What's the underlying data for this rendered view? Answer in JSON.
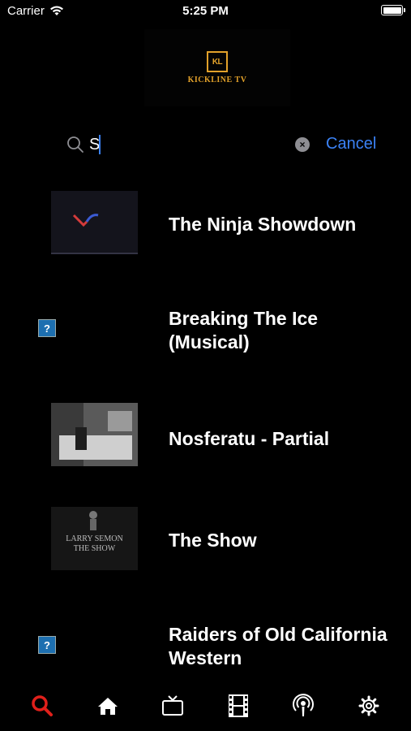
{
  "status_bar": {
    "carrier": "Carrier",
    "time": "5:25 PM"
  },
  "logo": {
    "mark": "KL",
    "text": "KICKLINE TV"
  },
  "search": {
    "value": "S",
    "cancel_label": "Cancel",
    "clear_symbol": "×"
  },
  "results": [
    {
      "title": "The Ninja Showdown",
      "thumbnail": "video-thumbnail"
    },
    {
      "title": "Breaking The Ice (Musical)",
      "thumbnail": "broken-image-icon",
      "placeholder": "?"
    },
    {
      "title": "Nosferatu - Partial",
      "thumbnail": "video-thumbnail"
    },
    {
      "title": "The Show",
      "thumbnail": "video-thumbnail",
      "thumb_text": [
        "LARRY SEMON",
        "THE SHOW"
      ]
    },
    {
      "title": "Raiders of Old California Western",
      "thumbnail": "broken-image-icon",
      "placeholder": "?"
    }
  ],
  "tabs": [
    {
      "icon": "search-icon",
      "active": true
    },
    {
      "icon": "home-icon",
      "active": false
    },
    {
      "icon": "tv-icon",
      "active": false
    },
    {
      "icon": "film-icon",
      "active": false
    },
    {
      "icon": "podcast-icon",
      "active": false
    },
    {
      "icon": "gear-icon",
      "active": false
    }
  ],
  "colors": {
    "background": "#000000",
    "accent": "#3b82f6",
    "active_tab": "#e0201b",
    "logo": "#e2a12a"
  }
}
